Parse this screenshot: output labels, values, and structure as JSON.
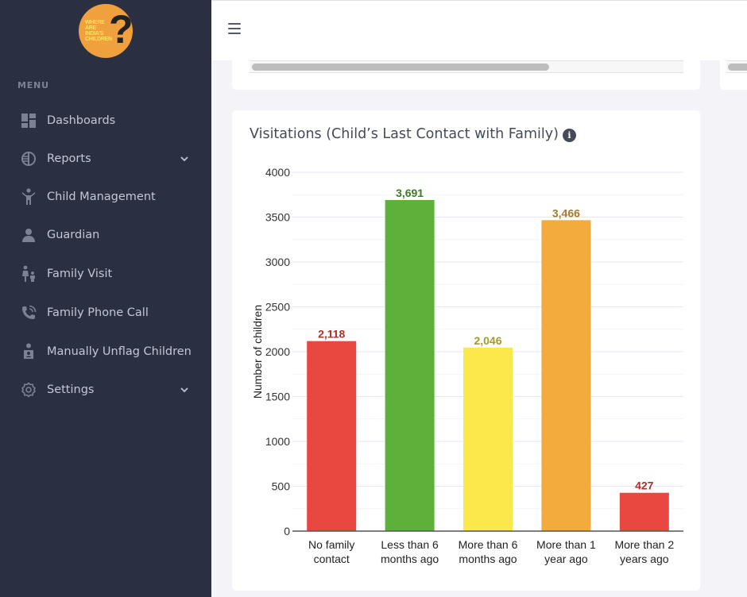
{
  "logo": {
    "text_lines": [
      "WHERE",
      "ARE",
      "INDIA'S",
      "CHILDREN"
    ],
    "mark": "?"
  },
  "sidebar": {
    "menu_title": "MENU",
    "items": [
      {
        "label": "Dashboards",
        "icon": "dashboard-icon",
        "has_chevron": false
      },
      {
        "label": "Reports",
        "icon": "reports-icon",
        "has_chevron": true
      },
      {
        "label": "Child Management",
        "icon": "child-icon",
        "has_chevron": false
      },
      {
        "label": "Guardian",
        "icon": "user-icon",
        "has_chevron": false
      },
      {
        "label": "Family Visit",
        "icon": "family-icon",
        "has_chevron": false
      },
      {
        "label": "Family Phone Call",
        "icon": "phone-call-icon",
        "has_chevron": false
      },
      {
        "label": "Manually Unflag Children",
        "icon": "unflag-child-icon",
        "has_chevron": false
      },
      {
        "label": "Settings",
        "icon": "gear-icon",
        "has_chevron": true
      }
    ]
  },
  "header": {
    "menu_icon": "hamburger-icon"
  },
  "card": {
    "title": "Visitations (Child’s Last Contact with Family)",
    "info_icon": "i"
  },
  "colors": {
    "sidebar_bg": "#2a3042",
    "red": "#e8483f",
    "green": "#5db13b",
    "yellow": "#fbe84b",
    "orange": "#f2ab3c"
  },
  "chart_data": {
    "type": "bar",
    "title": "Visitations (Child’s Last Contact with Family)",
    "xlabel": "",
    "ylabel": "Number of children",
    "ylim": [
      0,
      4000
    ],
    "yticks": [
      0,
      500,
      1000,
      1500,
      2000,
      2500,
      3000,
      3500,
      4000
    ],
    "grid": true,
    "categories": [
      [
        "No family",
        "contact"
      ],
      [
        "Less than 6",
        "months ago"
      ],
      [
        "More than 6",
        "months ago"
      ],
      [
        "More than 1",
        "year ago"
      ],
      [
        "More than 2",
        "years ago"
      ]
    ],
    "values": [
      2118,
      3691,
      2046,
      3466,
      427
    ],
    "value_labels": [
      "2,118",
      "3,691",
      "2,046",
      "3,466",
      "427"
    ],
    "bar_colors": [
      "#e8483f",
      "#5db13b",
      "#fbe84b",
      "#f2ab3c",
      "#e8483f"
    ],
    "label_colors": [
      "#a8322c",
      "#3f7a26",
      "#a39a2a",
      "#a8782a",
      "#a8322c"
    ]
  }
}
